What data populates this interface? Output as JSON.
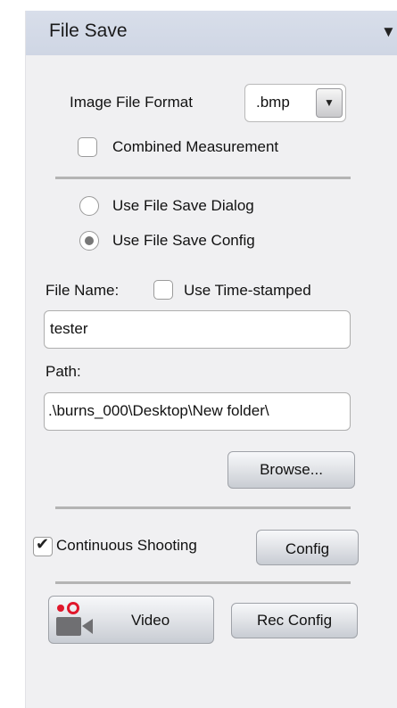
{
  "header": {
    "title": "File Save",
    "collapse_icon": "triangle-down-icon"
  },
  "format": {
    "label": "Image File Format",
    "value": ".bmp"
  },
  "combined": {
    "label": "Combined Measurement",
    "checked": false
  },
  "save_mode": {
    "dialog_label": "Use File Save Dialog",
    "config_label": "Use File Save Config",
    "selected": "config"
  },
  "file_name": {
    "label": "File Name:",
    "timestamp_label": "Use Time-stamped",
    "value": "tester"
  },
  "path": {
    "label": "Path:",
    "value": ".\\burns_000\\Desktop\\New folder\\"
  },
  "browse_label": "Browse...",
  "continuous": {
    "label": "Continuous Shooting",
    "checked": true,
    "config_label": "Config"
  },
  "video": {
    "label": "Video",
    "icon": "video-camera-record-icon",
    "rec_config_label": "Rec Config"
  },
  "colors": {
    "accent_red": "#e0172b",
    "camera_gray": "#6f6f72",
    "header_bg": "#d3d9e6"
  }
}
